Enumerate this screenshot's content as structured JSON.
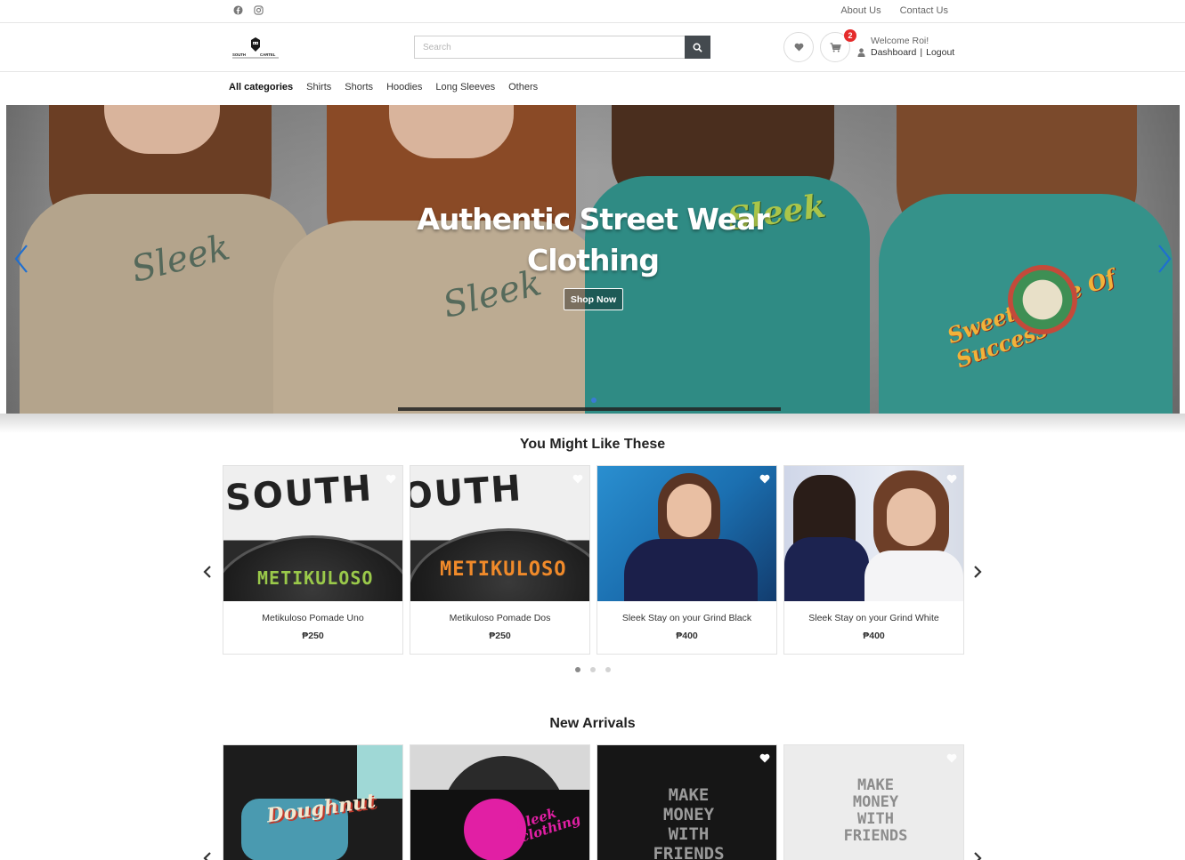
{
  "topbar": {
    "social_icons": [
      "facebook-icon",
      "instagram-icon"
    ],
    "links": [
      "About Us",
      "Contact Us"
    ]
  },
  "header": {
    "logo_text": "SOUTH CARTEL",
    "search_placeholder": "Search",
    "search_icon": "search-icon",
    "cart_count": "2",
    "welcome": "Welcome Roi!",
    "dashboard": "Dashboard",
    "separator": "|",
    "logout": "Logout"
  },
  "categories": [
    "All categories",
    "Shirts",
    "Shorts",
    "Hoodies",
    "Long Sleeves",
    "Others"
  ],
  "hero": {
    "title_line1": "Authentic Street Wear",
    "title_line2": "Clothing",
    "button": "Shop Now",
    "shirt_print_1": "Sleek",
    "shirt_print_2": "Sleek",
    "shirt_print_3": "Sleek",
    "back_print": "Sweet Taste Of Success",
    "active_slide": 1
  },
  "might_like": {
    "title": "You Might Like These",
    "products": [
      {
        "name": "Metikuloso Pomade Uno",
        "price": "₱250",
        "label": "METIKULOSO",
        "label_color": "#9ac94a"
      },
      {
        "name": "Metikuloso Pomade Dos",
        "price": "₱250",
        "label": "METIKULOSO",
        "label_color": "#f08a2a"
      },
      {
        "name": "Sleek Stay on your Grind Black",
        "price": "₱400"
      },
      {
        "name": "Sleek Stay on your Grind White",
        "price": "₱400"
      }
    ],
    "pages": 3,
    "active_page": 1
  },
  "new_arrivals": {
    "title": "New Arrivals",
    "products": [
      {
        "print": "Doughnut"
      },
      {
        "print": "Sleek clothing"
      },
      {
        "print": "MAKE MONEY WITH FRIENDS"
      },
      {
        "print": "MAKE MONEY WITH FRIENDS"
      }
    ]
  },
  "colors": {
    "accent_blue": "#1f6fd1",
    "badge_red": "#e52b2b",
    "search_button": "#444a4f"
  }
}
